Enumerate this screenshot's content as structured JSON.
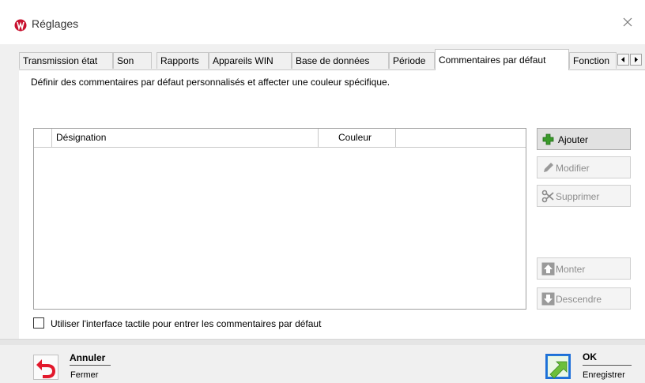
{
  "window": {
    "title": "Réglages"
  },
  "tabs": [
    {
      "label": "Transmission état"
    },
    {
      "label": "Son"
    },
    {
      "label": "Rapports"
    },
    {
      "label": "Appareils WIN"
    },
    {
      "label": "Base de données"
    },
    {
      "label": "Période"
    },
    {
      "label": "Commentaires par défaut",
      "active": true
    },
    {
      "label": "Fonction"
    }
  ],
  "description": "Définir des commentaires par défaut personnalisés et affecter une couleur spécifique.",
  "table": {
    "columns": [
      "Désignation",
      "Couleur"
    ],
    "rows": []
  },
  "actions": {
    "add": "Ajouter",
    "edit": "Modifier",
    "delete": "Supprimer",
    "up": "Monter",
    "down": "Descendre"
  },
  "touch_option": {
    "label": "Utiliser l'interface tactile pour entrer les commentaires par défaut",
    "checked": false
  },
  "footer": {
    "cancel_title": "Annuler",
    "cancel_sub": "Fermer",
    "ok_title": "OK",
    "ok_sub": "Enregistrer"
  },
  "colors": {
    "brand_red": "#c8102e",
    "add_green": "#3a9a2a",
    "ok_green": "#6cbf3a",
    "ok_border": "#1e6fd9",
    "cancel_red": "#e2192c"
  },
  "icons": [
    "app-logo-icon",
    "close-icon",
    "scroll-left-icon",
    "scroll-right-icon",
    "plus-icon",
    "pencil-icon",
    "scissors-icon",
    "arrow-up-icon",
    "arrow-down-icon",
    "undo-arrow-icon",
    "ok-arrow-icon"
  ]
}
